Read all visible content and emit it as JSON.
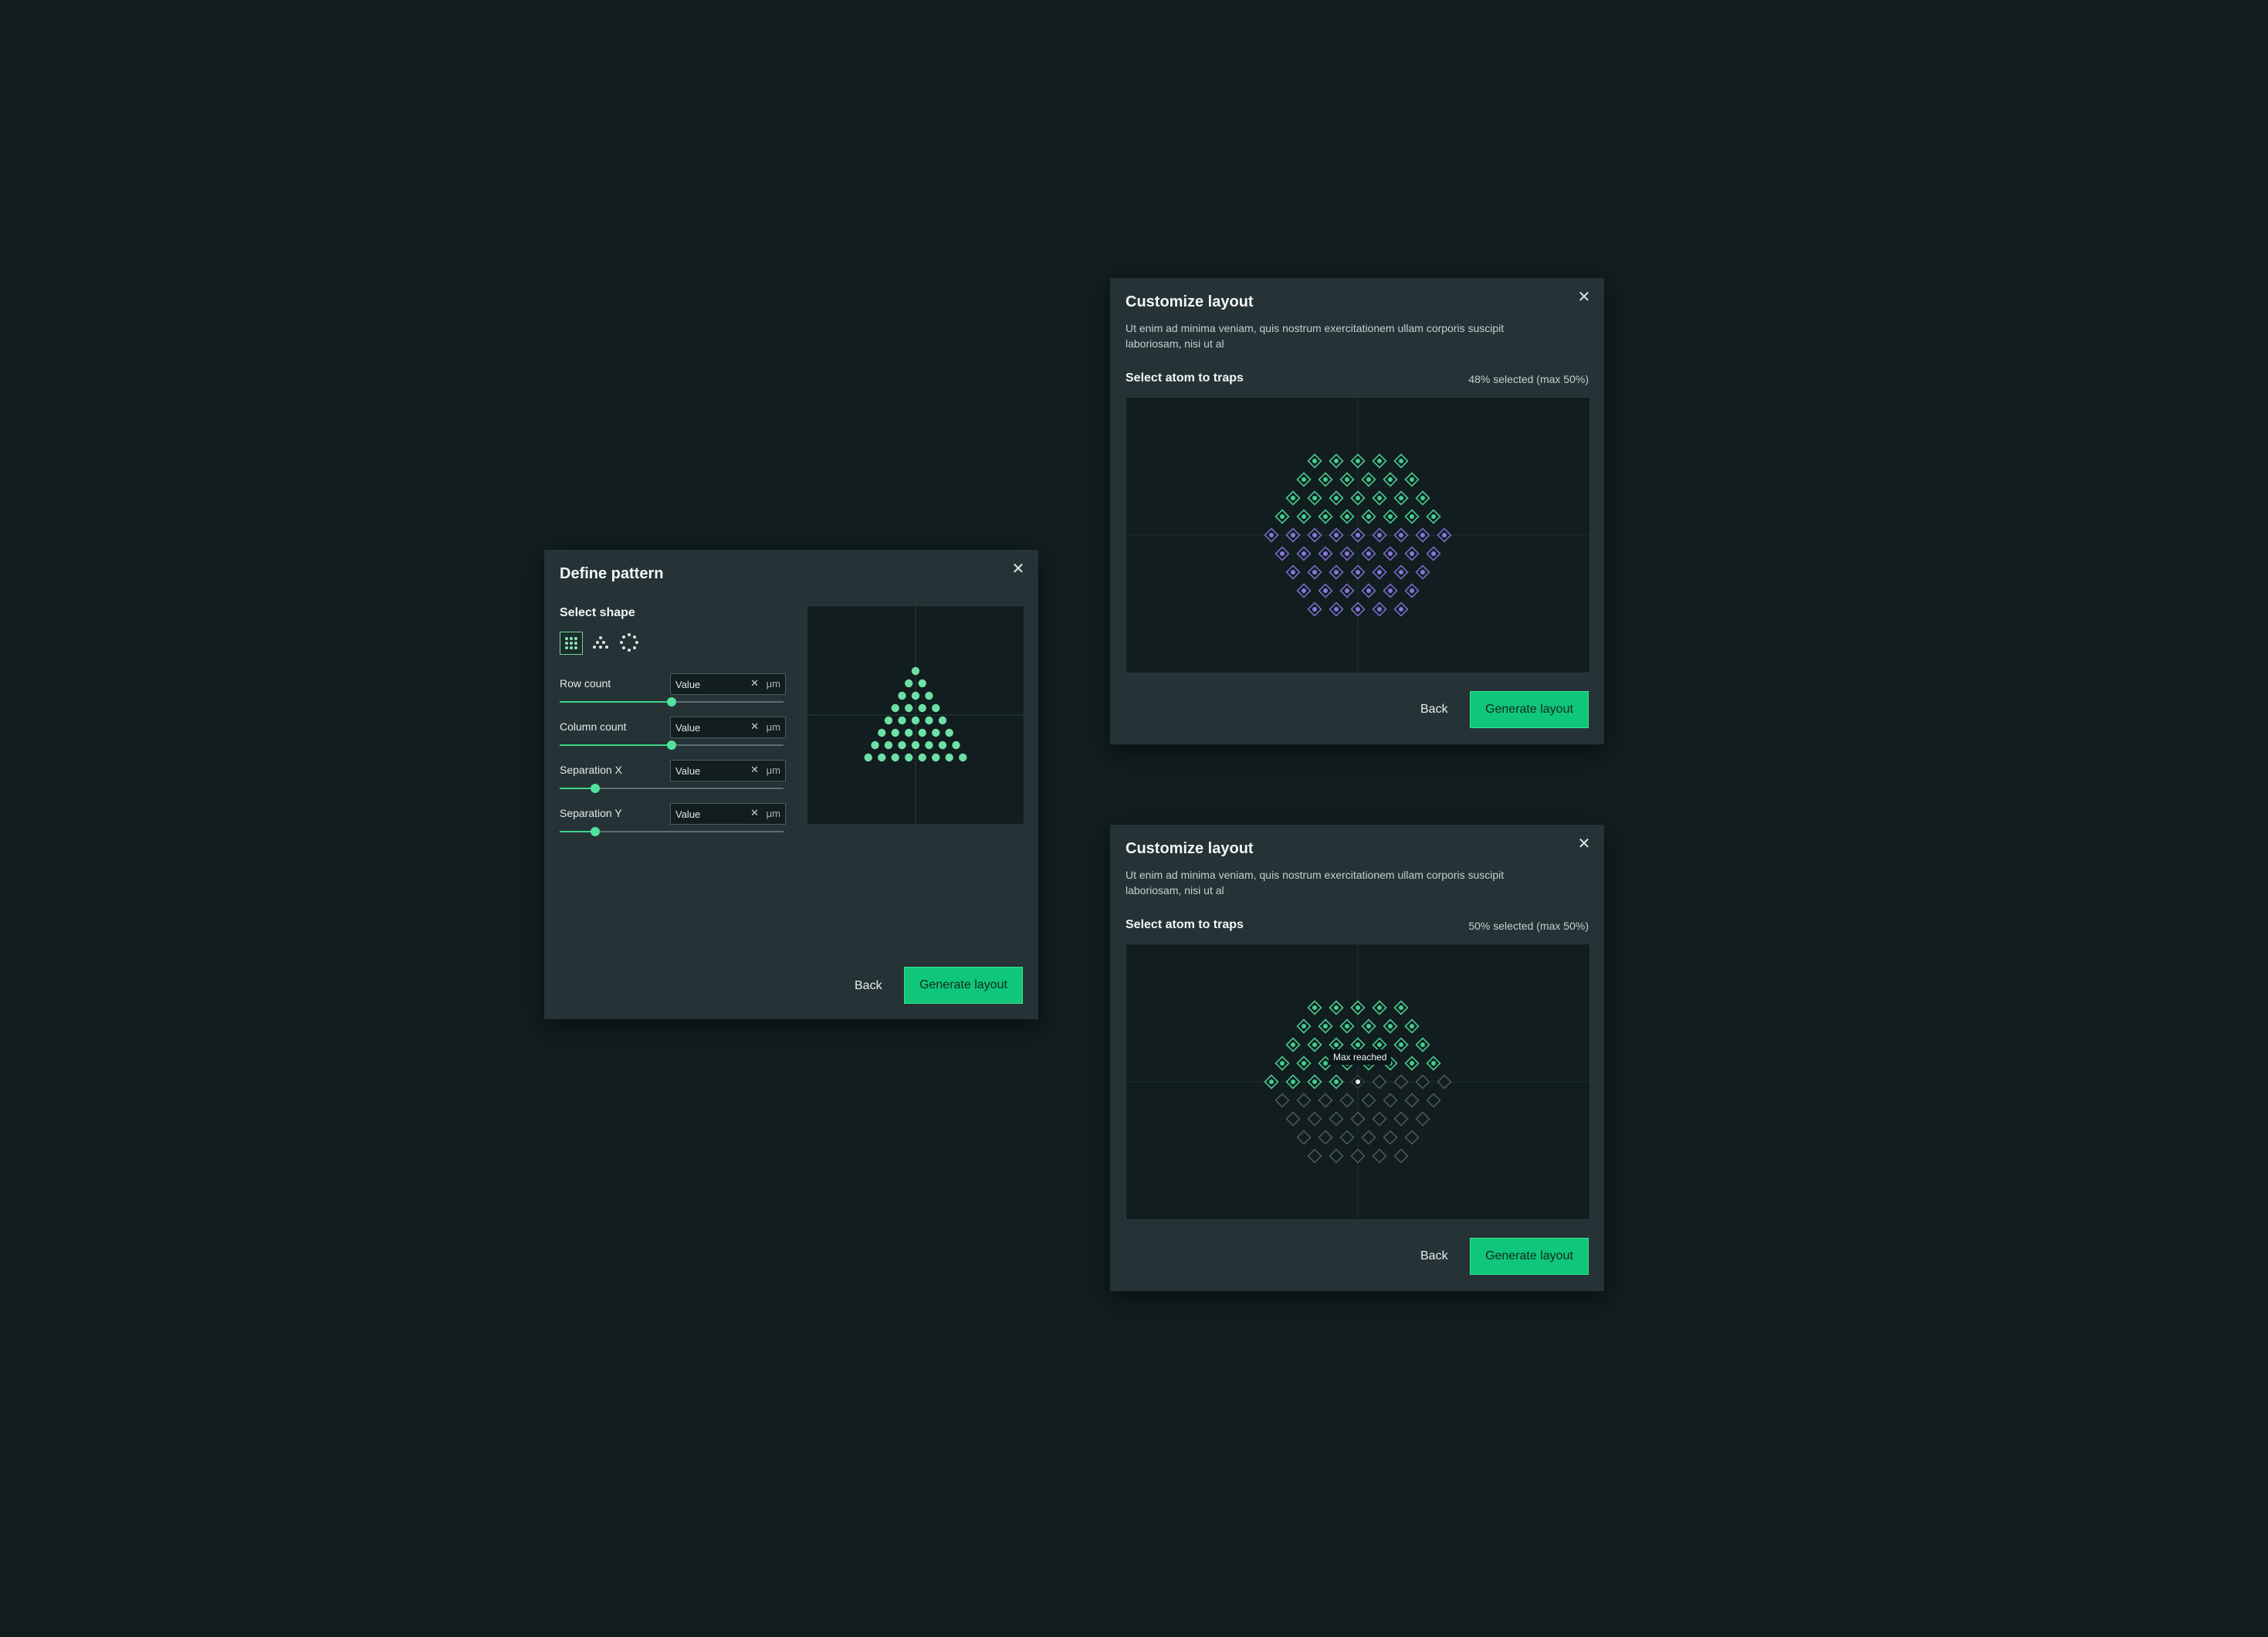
{
  "define_pattern": {
    "title": "Define pattern",
    "select_shape_label": "Select shape",
    "shapes": [
      {
        "icon": "grid-shape-icon",
        "active": true
      },
      {
        "icon": "triangle-shape-icon",
        "active": false
      },
      {
        "icon": "circle-shape-icon",
        "active": false
      }
    ],
    "controls": [
      {
        "label": "Row count",
        "placeholder": "Value",
        "unit": "μm",
        "level": 0.5
      },
      {
        "label": "Column count",
        "placeholder": "Value",
        "unit": "μm",
        "level": 0.5
      },
      {
        "label": "Separation X",
        "placeholder": "Value",
        "unit": "μm",
        "level": 0.16
      },
      {
        "label": "Separation Y",
        "placeholder": "Value",
        "unit": "μm",
        "level": 0.16
      }
    ],
    "preview_rows": 8,
    "back_label": "Back",
    "generate_label": "Generate layout",
    "accent": "#10c67a"
  },
  "customize_1": {
    "title": "Customize layout",
    "description": "Ut enim ad minima veniam, quis nostrum exercitationem ullam corporis suscipit laboriosam, nisi ut al",
    "section_label": "Select atom to traps",
    "selection_status": "48% selected (max 50%)",
    "back_label": "Back",
    "generate_label": "Generate layout",
    "selected_rows": 4,
    "row_counts": [
      5,
      6,
      7,
      8,
      9,
      8,
      7,
      6,
      5
    ],
    "colors": {
      "selected": "#3fcf8f",
      "unselected": "#8878d8"
    }
  },
  "customize_2": {
    "title": "Customize layout",
    "description": "Ut enim ad minima veniam, quis nostrum exercitationem ullam corporis suscipit laboriosam, nisi ut al",
    "section_label": "Select atom to traps",
    "selection_status": "50% selected (max 50%)",
    "back_label": "Back",
    "generate_label": "Generate layout",
    "tooltip": "Max reached",
    "row_counts": [
      5,
      6,
      7,
      8,
      9,
      8,
      7,
      6,
      5
    ],
    "colors": {
      "selected": "#3fcf8f",
      "disabled": "#4a5759"
    }
  }
}
